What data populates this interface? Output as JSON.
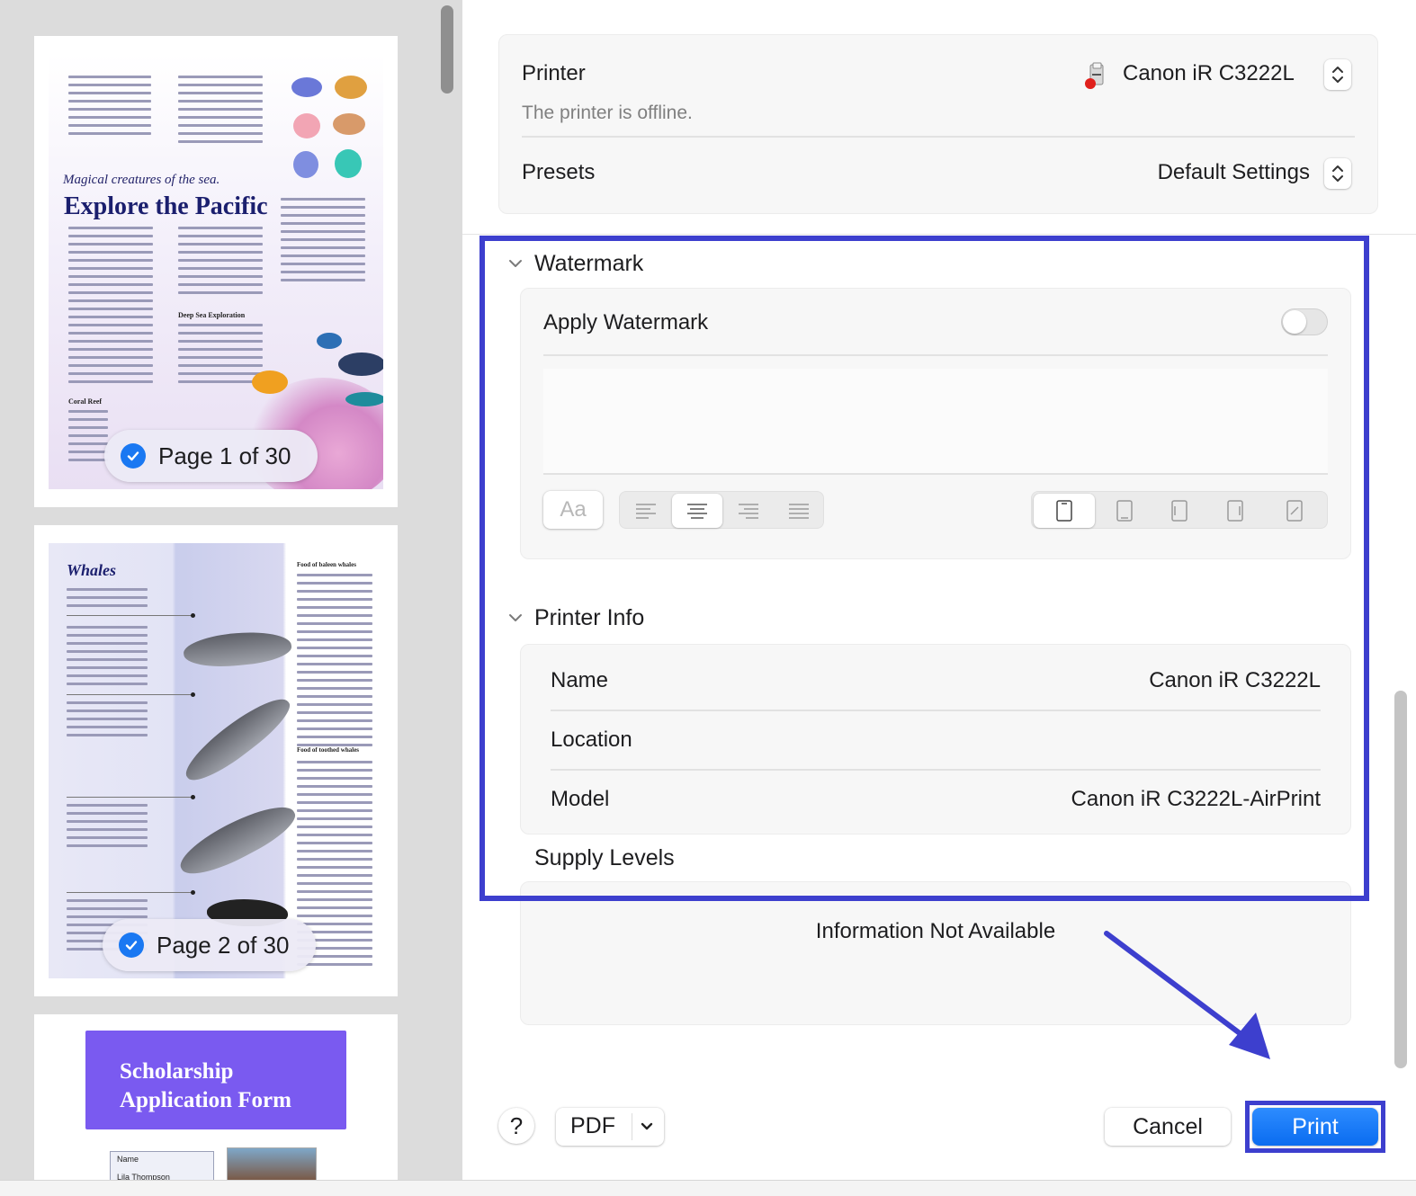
{
  "preview": {
    "pages": [
      {
        "badge": "Page 1 of 30",
        "subtitle": "Magical creatures of the sea.",
        "title": "Explore the Pacific",
        "headings": [
          "Deep Sea Exploration",
          "Coral Reef"
        ]
      },
      {
        "badge": "Page 2 of 30",
        "title": "Whales",
        "headings": [
          "Food of baleen whales",
          "Food of toothed whales"
        ]
      },
      {
        "title": "Scholarship Application Form",
        "name_label": "Name",
        "name_value": "Lila Thompson"
      }
    ]
  },
  "printer": {
    "label": "Printer",
    "value": "Canon iR C3222L",
    "status": "The printer is offline.",
    "status_color": "#e0201c"
  },
  "presets": {
    "label": "Presets",
    "value": "Default Settings"
  },
  "watermark": {
    "section_title": "Watermark",
    "apply_label": "Apply Watermark",
    "apply_enabled": false,
    "font_button": "Aa",
    "alignment_options": [
      "align-left-icon",
      "align-center-icon",
      "align-right-icon",
      "align-justify-icon"
    ],
    "alignment_selected": "align-center-icon",
    "position_options": [
      "page-front-icon",
      "page-bottom-icon",
      "page-left-icon",
      "page-right-icon",
      "page-diagonal-icon"
    ],
    "position_selected": "page-front-icon"
  },
  "printer_info": {
    "section_title": "Printer Info",
    "rows": [
      {
        "label": "Name",
        "value": "Canon iR C3222L"
      },
      {
        "label": "Location",
        "value": ""
      },
      {
        "label": "Model",
        "value": "Canon iR C3222L-AirPrint"
      }
    ]
  },
  "supply_levels": {
    "section_title": "Supply Levels",
    "message": "Information Not Available"
  },
  "footer": {
    "help_label": "?",
    "pdf_label": "PDF",
    "cancel_label": "Cancel",
    "print_label": "Print"
  },
  "colors": {
    "accent": "#0a6cf0",
    "annotation": "#3d3fce"
  }
}
